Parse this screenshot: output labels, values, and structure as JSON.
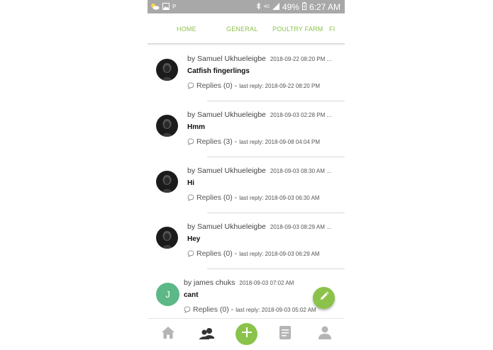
{
  "status": {
    "carrier": "P",
    "network": "4G",
    "battery": "49%",
    "time": "6:27 AM"
  },
  "tabs": [
    {
      "label": "HOME"
    },
    {
      "label": "GENERAL"
    },
    {
      "label": "POULTRY FARM"
    },
    {
      "label": "FI"
    }
  ],
  "posts": [
    {
      "author": "by Samuel Ukhueleigbe",
      "date": "2018-09-22 08:20 PM ...",
      "title": "Catfish fingerlings",
      "replies": "Replies (0) -",
      "last_reply": "last reply: 2018-09-22 08:20 PM"
    },
    {
      "author": "by Samuel Ukhueleigbe",
      "date": "2018-09-03 02:28 PM ...",
      "title": "Hmm",
      "replies": "Replies (3) -",
      "last_reply": "last reply: 2018-09-08 04:04 PM"
    },
    {
      "author": "by Samuel Ukhueleigbe",
      "date": "2018-09-03 08:30 AM ...",
      "title": "Hi",
      "replies": "Replies (0) -",
      "last_reply": "last reply: 2018-09-03 06:30 AM"
    },
    {
      "author": "by Samuel Ukhueleigbe",
      "date": "2018-09-03 08:29 AM ...",
      "title": "Hey",
      "replies": "Replies (0) -",
      "last_reply": "last reply: 2018-09-03 06:29 AM"
    },
    {
      "author": "by james chuks",
      "date": "2018-09-03 07:02 AM",
      "title": "cant",
      "replies": "Replies (0) -",
      "last_reply": "last reply: 2018-09-03 05:02 AM",
      "avatar_letter": "J"
    }
  ],
  "bottom_nav": [
    {
      "icon": "home-icon"
    },
    {
      "icon": "chat-bubbles-icon"
    },
    {
      "icon": "add-icon"
    },
    {
      "icon": "document-icon"
    },
    {
      "icon": "profile-icon"
    }
  ],
  "colors": {
    "accent": "#8bc34a",
    "status_bar": "#a8a8a8",
    "letter_avatar": "#5cb887"
  }
}
